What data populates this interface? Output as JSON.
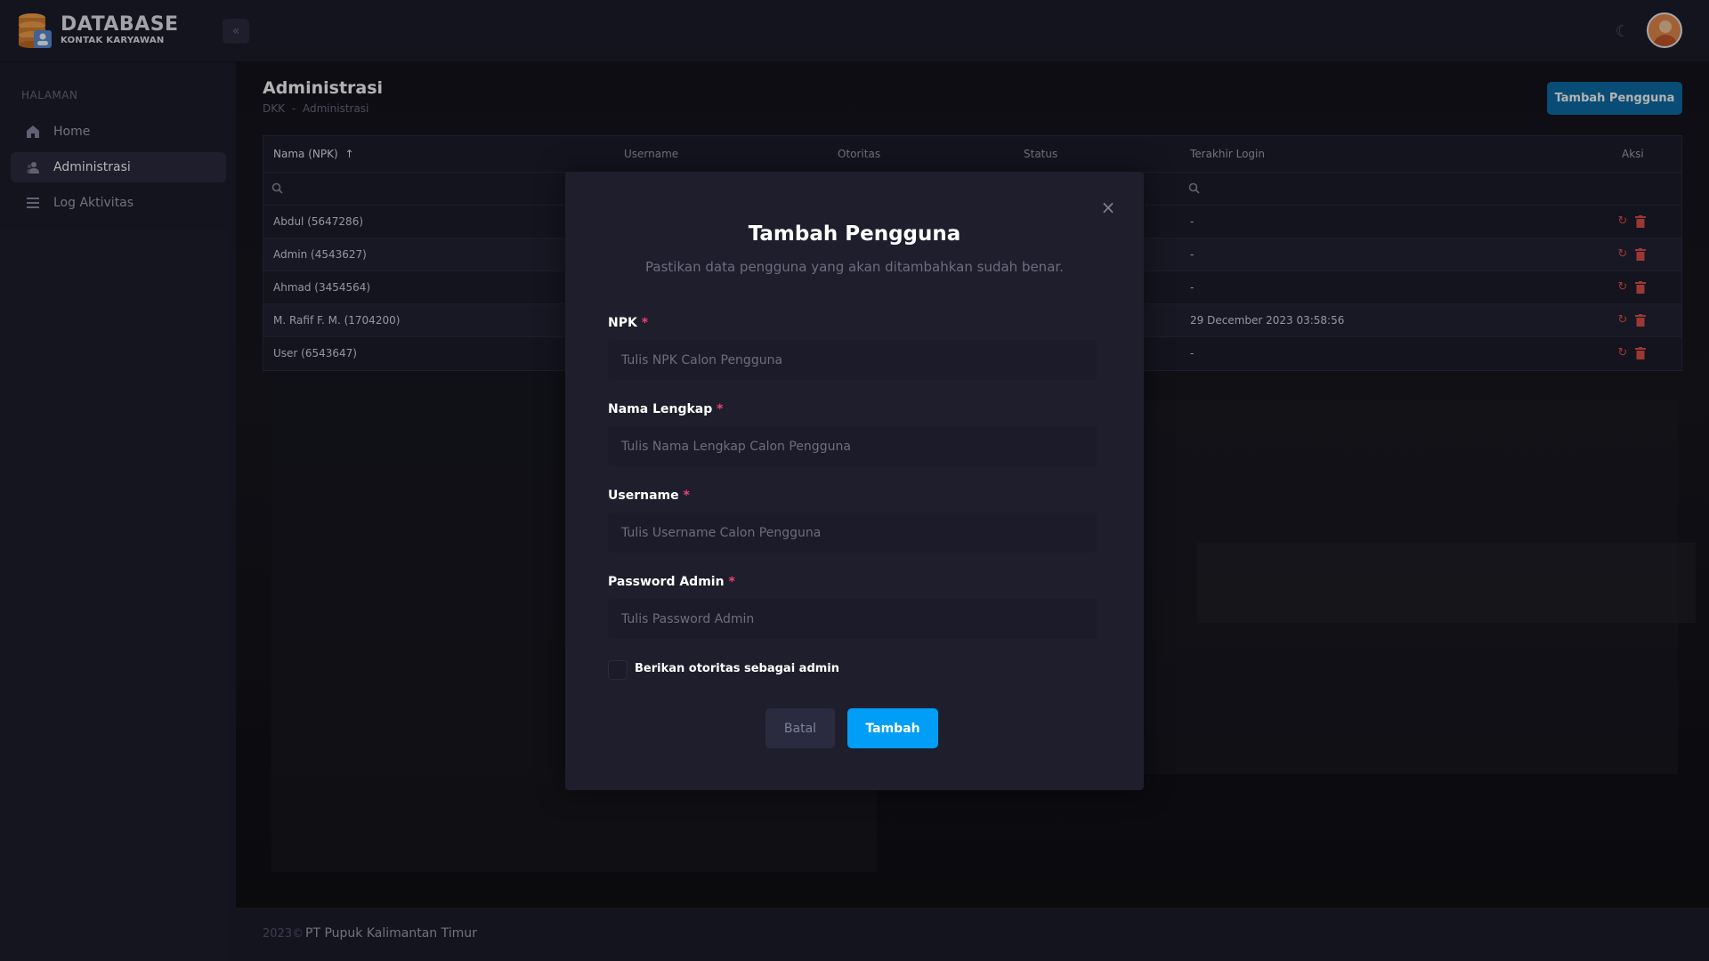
{
  "app": {
    "logo_title": "DATABASE",
    "logo_subtitle": "KONTAK KARYAWAN"
  },
  "sidebar": {
    "section_label": "HALAMAN",
    "items": [
      {
        "label": "Home",
        "icon": "home-icon"
      },
      {
        "label": "Administrasi",
        "icon": "users-icon",
        "active": true
      },
      {
        "label": "Log Aktivitas",
        "icon": "list-icon"
      }
    ]
  },
  "page": {
    "title": "Administrasi",
    "breadcrumb": [
      "DKK",
      "Administrasi"
    ],
    "breadcrumb_separator": "-",
    "add_button_label": "Tambah Pengguna"
  },
  "table": {
    "columns": [
      "Nama (NPK)",
      "Username",
      "Otoritas",
      "Status",
      "Terakhir Login",
      "Aksi"
    ],
    "sort_indicator": "↑",
    "rows": [
      {
        "name": "Abdul (5647286)",
        "last_login": "-"
      },
      {
        "name": "Admin (4543627)",
        "last_login": "-"
      },
      {
        "name": "Ahmad (3454564)",
        "last_login": "-"
      },
      {
        "name": "M. Rafif F. M. (1704200)",
        "last_login": "29 December 2023 03:58:56"
      },
      {
        "name": "User (6543647)",
        "last_login": "-"
      }
    ]
  },
  "footer": {
    "year": "2023©",
    "company": "PT Pupuk Kalimantan Timur"
  },
  "modal": {
    "title": "Tambah Pengguna",
    "subtitle": "Pastikan data pengguna yang akan ditambahkan sudah benar.",
    "required_mark": "*",
    "fields": [
      {
        "label": "NPK",
        "placeholder": "Tulis NPK Calon Pengguna",
        "value": ""
      },
      {
        "label": "Nama Lengkap",
        "placeholder": "Tulis Nama Lengkap Calon Pengguna",
        "value": ""
      },
      {
        "label": "Username",
        "placeholder": "Tulis Username Calon Pengguna",
        "value": ""
      },
      {
        "label": "Password Admin",
        "placeholder": "Tulis Password Admin",
        "value": ""
      }
    ],
    "checkbox_label": "Berikan otoritas sebagai admin",
    "checkbox_checked": false,
    "cancel_label": "Batal",
    "submit_label": "Tambah"
  },
  "colors": {
    "primary": "#009ef7",
    "danger": "#f1416c",
    "action_red": "#e0514a",
    "header_button": "#0d6eaa"
  }
}
